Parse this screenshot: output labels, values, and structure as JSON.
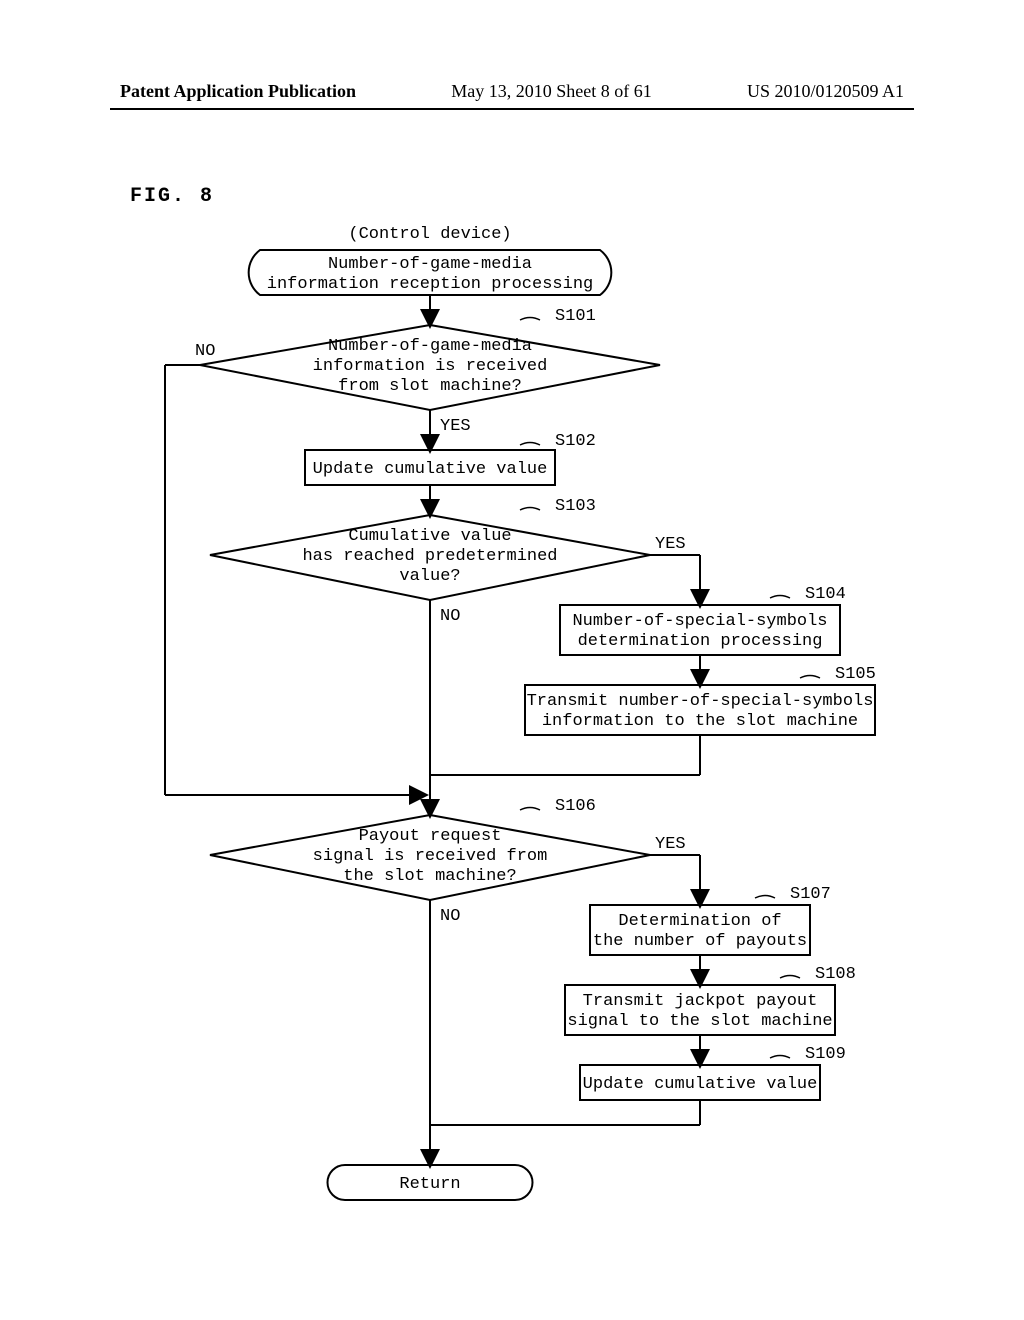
{
  "header": {
    "left": "Patent Application Publication",
    "center": "May 13, 2010  Sheet 8 of 61",
    "right": "US 2010/0120509 A1"
  },
  "fig_label": "FIG. 8",
  "chart_data": {
    "type": "flowchart",
    "title": "(Control device)",
    "nodes": [
      {
        "id": "start",
        "type": "terminal",
        "text": "Number-of-game-media information reception processing"
      },
      {
        "id": "s101",
        "type": "decision",
        "label": "S101",
        "text": "Number-of-game-media information is received from slot machine?",
        "yes": "s102",
        "no": "loop_back_start"
      },
      {
        "id": "s102",
        "type": "process",
        "label": "S102",
        "text": "Update cumulative value",
        "next": "s103"
      },
      {
        "id": "s103",
        "type": "decision",
        "label": "S103",
        "text": "Cumulative value has reached predetermined value?",
        "yes": "s104",
        "no": "s106"
      },
      {
        "id": "s104",
        "type": "process",
        "label": "S104",
        "text": "Number-of-special-symbols determination processing",
        "next": "s105"
      },
      {
        "id": "s105",
        "type": "process",
        "label": "S105",
        "text": "Transmit number-of-special-symbols information to the slot machine",
        "next": "s106"
      },
      {
        "id": "s106",
        "type": "decision",
        "label": "S106",
        "text": "Payout request signal is received from the slot machine?",
        "yes": "s107",
        "no": "return"
      },
      {
        "id": "s107",
        "type": "process",
        "label": "S107",
        "text": "Determination of the number of payouts",
        "next": "s108"
      },
      {
        "id": "s108",
        "type": "process",
        "label": "S108",
        "text": "Transmit jackpot payout signal to the slot machine",
        "next": "s109"
      },
      {
        "id": "s109",
        "type": "process",
        "label": "S109",
        "text": "Update cumulative value",
        "next": "return"
      },
      {
        "id": "return",
        "type": "terminal",
        "text": "Return"
      }
    ],
    "branch_labels": {
      "yes": "YES",
      "no": "NO"
    }
  },
  "flow": {
    "title": "(Control device)",
    "start": "Number-of-game-media information reception processing",
    "s101_label": "S101",
    "s101_text1": "Number-of-game-media",
    "s101_text2": "information is received",
    "s101_text3": "from slot machine?",
    "s102_label": "S102",
    "s102_text": "Update cumulative value",
    "s103_label": "S103",
    "s103_text1": "Cumulative value",
    "s103_text2": "has reached predetermined",
    "s103_text3": "value?",
    "s104_label": "S104",
    "s104_text1": "Number-of-special-symbols",
    "s104_text2": "determination processing",
    "s105_label": "S105",
    "s105_text1": "Transmit number-of-special-symbols",
    "s105_text2": "information to the slot machine",
    "s106_label": "S106",
    "s106_text1": "Payout request",
    "s106_text2": "signal is received from",
    "s106_text3": "the slot machine?",
    "s107_label": "S107",
    "s107_text1": "Determination of",
    "s107_text2": "the number of payouts",
    "s108_label": "S108",
    "s108_text1": "Transmit jackpot payout",
    "s108_text2": "signal to the slot machine",
    "s109_label": "S109",
    "s109_text": "Update cumulative value",
    "return": "Return",
    "yes": "YES",
    "no": "NO"
  }
}
